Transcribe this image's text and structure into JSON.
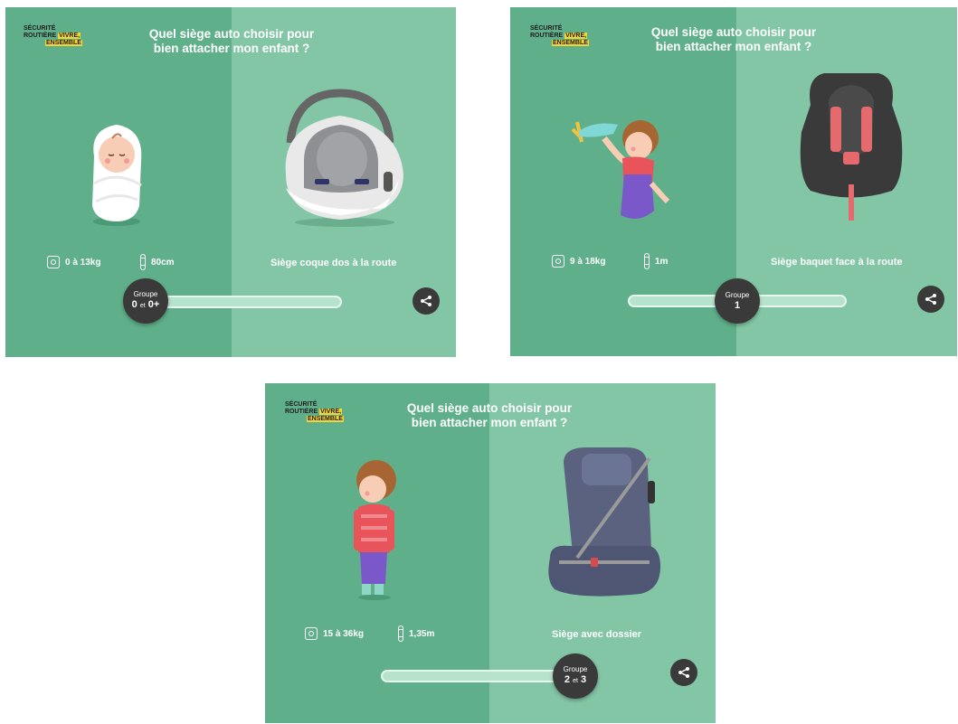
{
  "logo": {
    "line1": "SÉCURITÉ",
    "line2_a": "ROUTIÈRE",
    "line2_b": "VIVRE,",
    "line3": "ENSEMBLE"
  },
  "title": "Quel siège auto choisir pour bien attacher mon enfant ?",
  "panels": [
    {
      "weight": "0 à 13kg",
      "height": "80cm",
      "seat": "Siège coque dos à la route",
      "group_label": "Groupe",
      "group_a": "0",
      "group_sep": "et",
      "group_b": "0+",
      "slider_position": 0
    },
    {
      "weight": "9 à 18kg",
      "height": "1m",
      "seat": "Siège baquet face à la route",
      "group_label": "Groupe",
      "group_a": "1",
      "group_sep": "",
      "group_b": "",
      "slider_position": 0.5
    },
    {
      "weight": "15 à 36kg",
      "height": "1,35m",
      "seat": "Siège avec dossier",
      "group_label": "Groupe",
      "group_a": "2",
      "group_sep": "et",
      "group_b": "3",
      "slider_position": 1
    }
  ],
  "icons": {
    "weight": "scale-icon",
    "height": "ruler-icon",
    "share": "share-icon"
  },
  "colors": {
    "left_bg": "#5fb08a",
    "right_bg": "#83c6a6",
    "knob": "#3a3a3a",
    "logo_highlight": "#f5d532"
  }
}
